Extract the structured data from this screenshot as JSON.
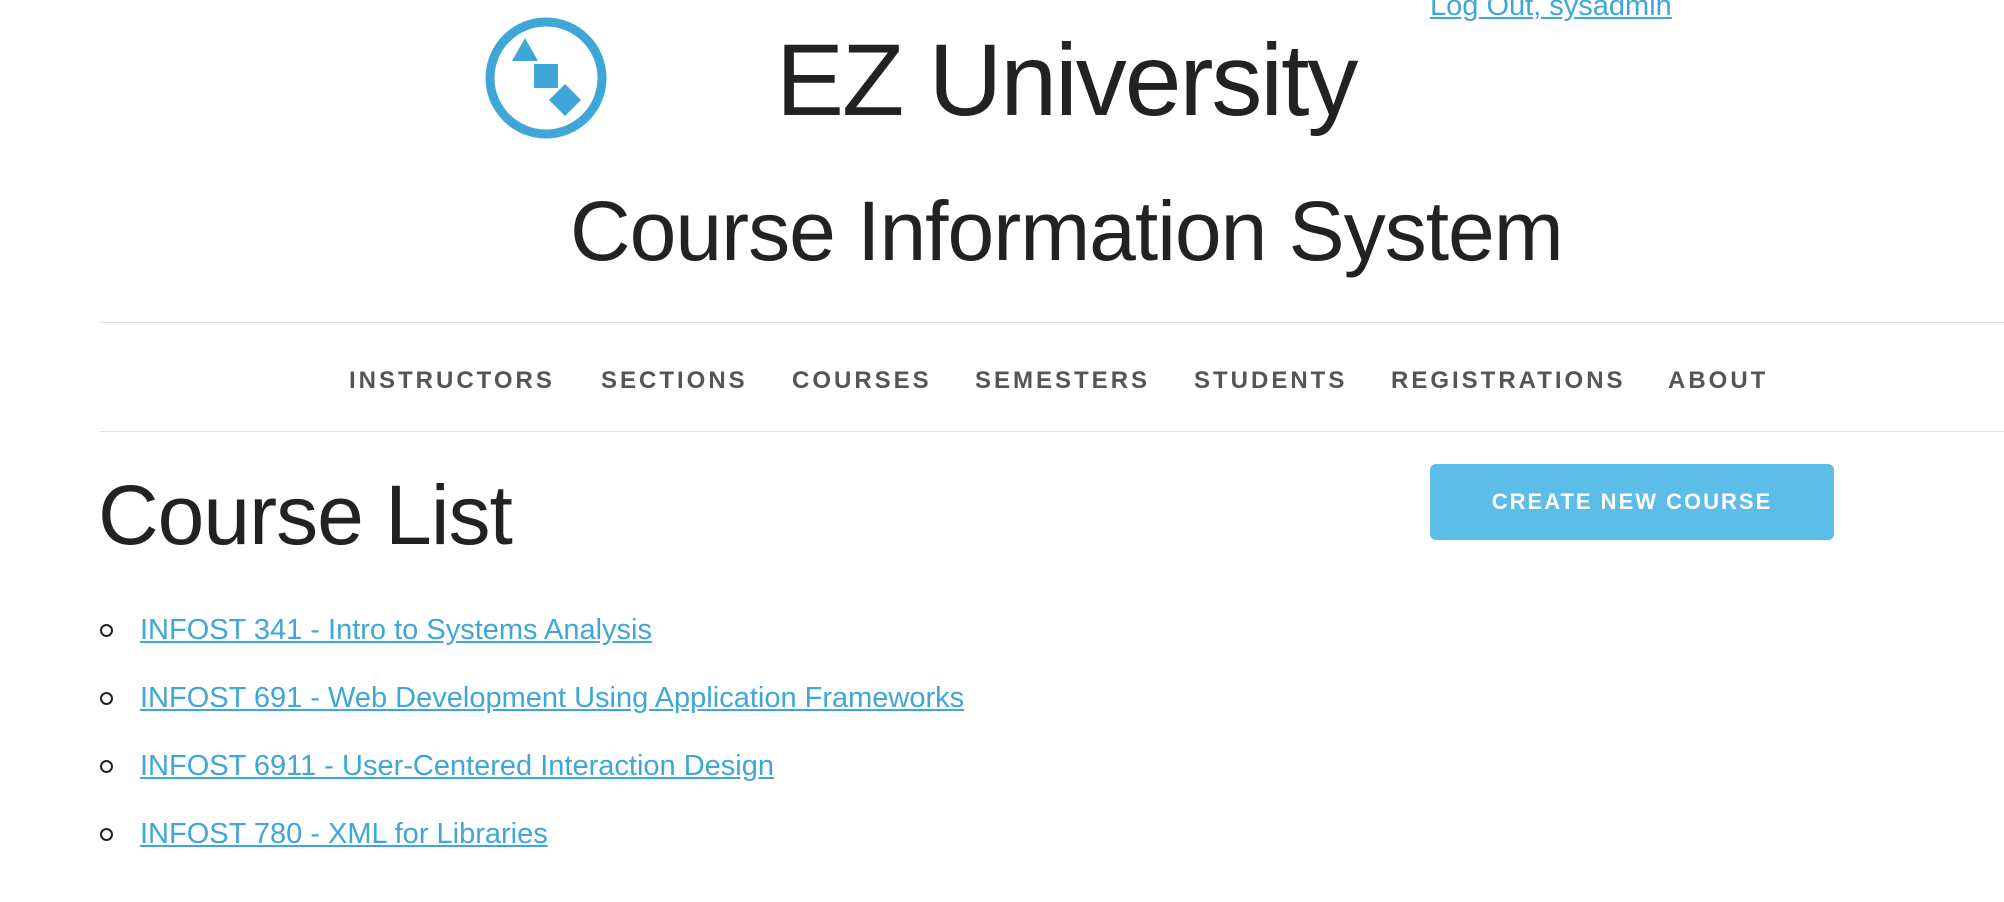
{
  "header": {
    "logout_label": "Log Out, sysadmin",
    "site_title": "EZ University",
    "site_subtitle": "Course Information System",
    "logo_icon": "shapes-logo-icon"
  },
  "nav": {
    "items": [
      {
        "label": "INSTRUCTORS"
      },
      {
        "label": "SECTIONS"
      },
      {
        "label": "COURSES"
      },
      {
        "label": "SEMESTERS"
      },
      {
        "label": "STUDENTS"
      },
      {
        "label": "REGISTRATIONS"
      },
      {
        "label": "ABOUT"
      }
    ]
  },
  "main": {
    "heading": "Course List",
    "create_button_label": "CREATE NEW COURSE",
    "courses": [
      {
        "label": "INFOST 341 - Intro to Systems Analysis"
      },
      {
        "label": "INFOST 691 - Web Development Using Application Frameworks"
      },
      {
        "label": "INFOST 6911 - User-Centered Interaction Design"
      },
      {
        "label": "INFOST 780 - XML for Libraries"
      }
    ]
  },
  "colors": {
    "accent": "#3fa7d8",
    "button_bg": "#5bbde8",
    "logo": "#3fa7d8",
    "nav_text": "#555555",
    "text": "#222222"
  }
}
